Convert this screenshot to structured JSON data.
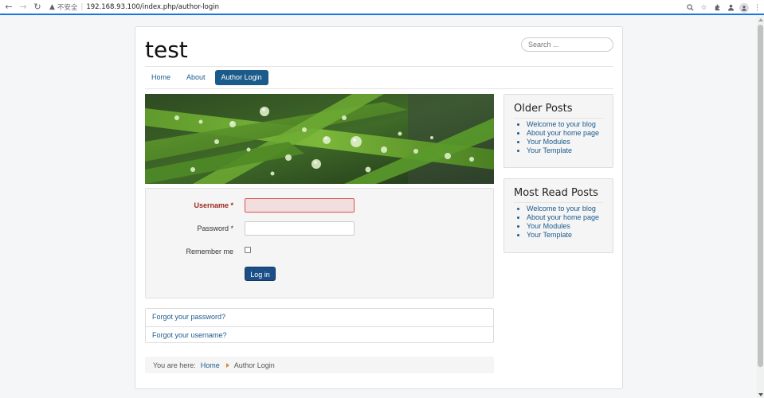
{
  "browser": {
    "insecure_label": "不安全",
    "url": "192.168.93.100/index.php/author-login",
    "icons": [
      "back-arrow-icon",
      "forward-arrow-icon",
      "reload-icon",
      "warning-icon",
      "zoom-icon",
      "star-icon",
      "extensions-icon",
      "profile-manager-icon",
      "avatar-icon",
      "menu-icon"
    ]
  },
  "site": {
    "title": "test",
    "search_placeholder": "Search ..."
  },
  "menu": {
    "items": [
      {
        "label": "Home",
        "active": false
      },
      {
        "label": "About",
        "active": false
      },
      {
        "label": "Author Login",
        "active": true
      }
    ]
  },
  "login_form": {
    "username_label": "Username *",
    "password_label": "Password *",
    "remember_label": "Remember me",
    "submit_label": "Log in"
  },
  "links": {
    "forgot_password": "Forgot your password?",
    "forgot_username": "Forgot your username?"
  },
  "breadcrumb": {
    "prefix": "You are here:",
    "home": "Home",
    "current": "Author Login"
  },
  "sidebar": {
    "older_posts": {
      "title": "Older Posts",
      "items": [
        "Welcome to your blog",
        "About your home page",
        "Your Modules",
        "Your Template"
      ]
    },
    "most_read": {
      "title": "Most Read Posts",
      "items": [
        "Welcome to your blog",
        "About your home page",
        "Your Modules",
        "Your Template"
      ]
    }
  },
  "colors": {
    "accent": "#1a5b8b",
    "link": "#1b5a8e",
    "error": "#9d261d",
    "browser_accent": "#1a73e8"
  }
}
